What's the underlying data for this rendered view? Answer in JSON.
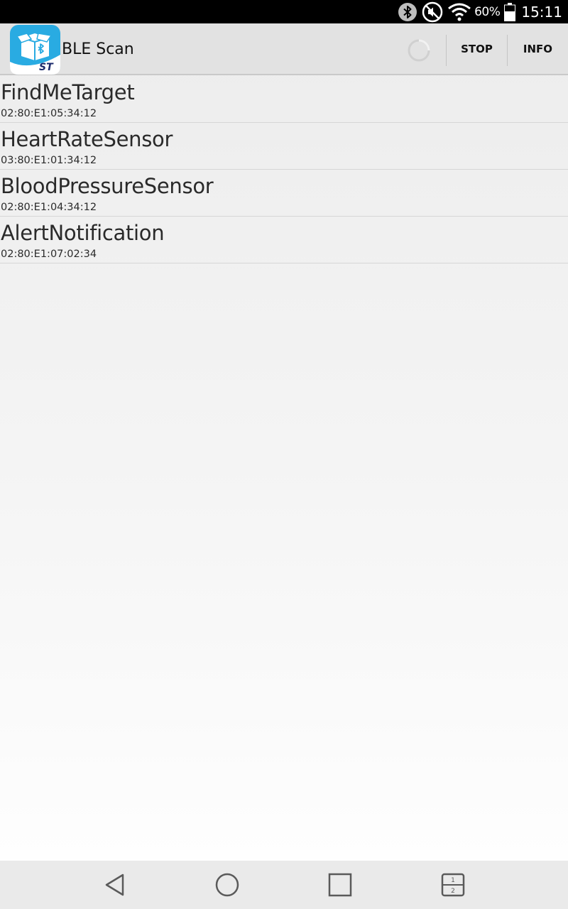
{
  "status_bar": {
    "icons": [
      "bluetooth-icon",
      "mute-icon",
      "wifi-icon",
      "battery-icon"
    ],
    "battery_percent": "60%",
    "time": "15:11"
  },
  "action_bar": {
    "title": "BLE Scan",
    "stop_label": "STOP",
    "info_label": "INFO"
  },
  "devices": [
    {
      "name": "FindMeTarget",
      "address": "02:80:E1:05:34:12"
    },
    {
      "name": "HeartRateSensor",
      "address": "03:80:E1:01:34:12"
    },
    {
      "name": "BloodPressureSensor",
      "address": "02:80:E1:04:34:12"
    },
    {
      "name": "AlertNotification",
      "address": "02:80:E1:07:02:34"
    }
  ],
  "nav_bar": {
    "buttons": [
      "back-icon",
      "home-icon",
      "recents-icon",
      "dual-window-icon"
    ]
  },
  "colors": {
    "status_bar_bg": "#000000",
    "action_bar_bg": "#e2e2e2",
    "logo_blue": "#29abe2",
    "text": "#2a2a2a"
  }
}
